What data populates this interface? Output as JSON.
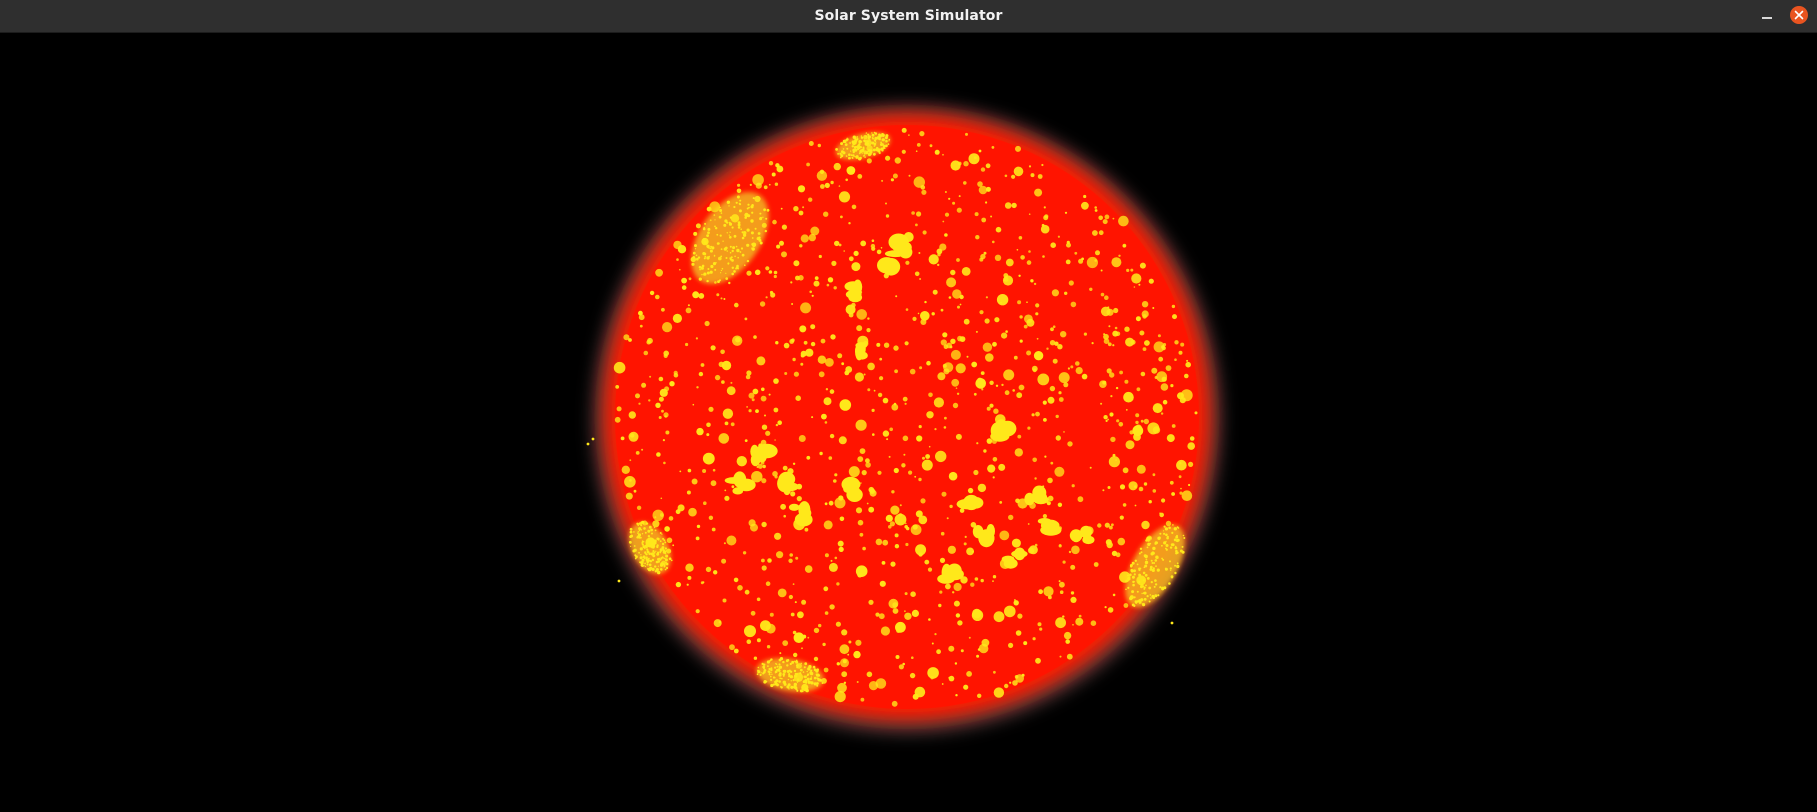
{
  "window": {
    "title": "Solar System Simulator"
  },
  "controls": {
    "minimize_icon": "minimize-icon",
    "close_icon": "close-icon",
    "close_color": "#e95420"
  },
  "scene": {
    "object": "sun",
    "surface_color": "#ff1a00",
    "spot_color": "#ffe81a",
    "background_color": "#000000"
  }
}
